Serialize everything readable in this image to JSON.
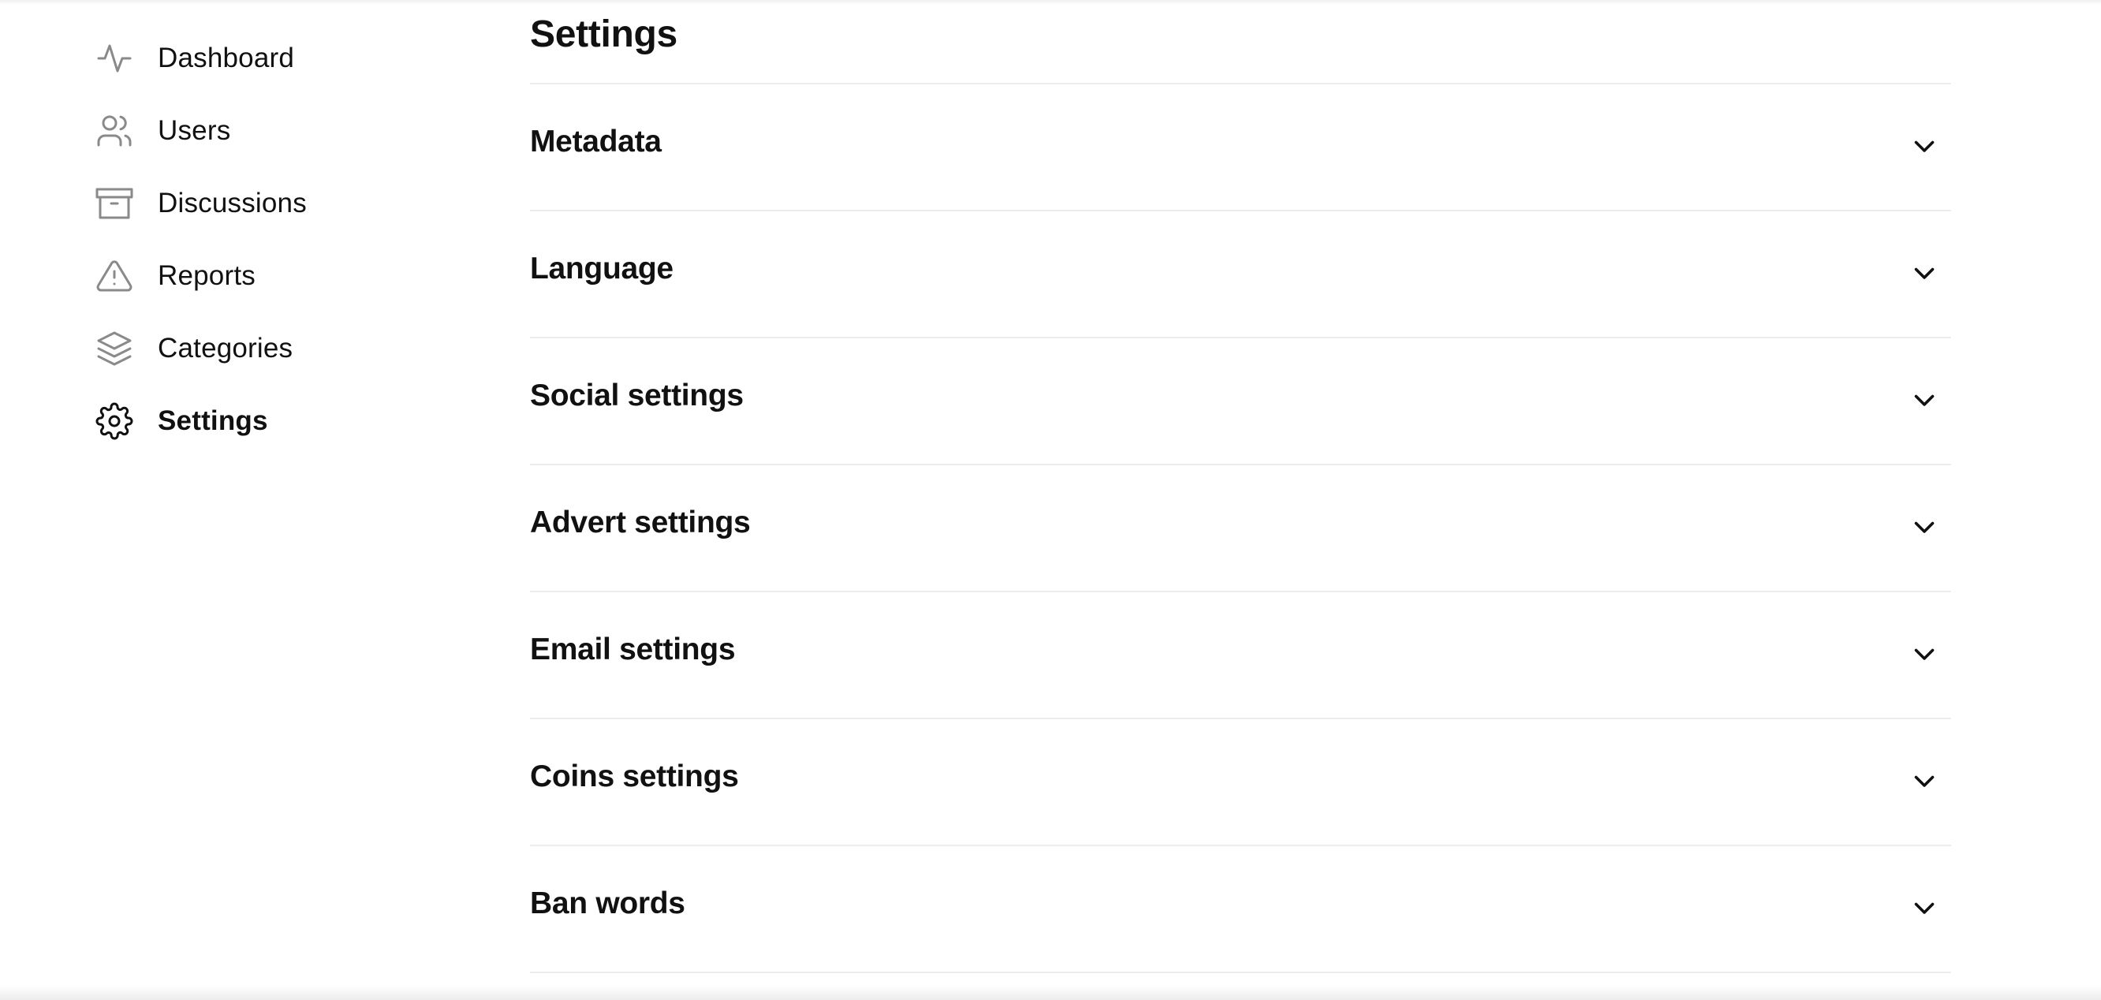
{
  "sidebar": {
    "items": [
      {
        "label": "Dashboard",
        "icon": "activity-icon",
        "active": false
      },
      {
        "label": "Users",
        "icon": "users-icon",
        "active": false
      },
      {
        "label": "Discussions",
        "icon": "archive-icon",
        "active": false
      },
      {
        "label": "Reports",
        "icon": "alert-triangle-icon",
        "active": false
      },
      {
        "label": "Categories",
        "icon": "layers-icon",
        "active": false
      },
      {
        "label": "Settings",
        "icon": "gear-icon",
        "active": true
      }
    ]
  },
  "main": {
    "title": "Settings",
    "sections": [
      {
        "label": "Metadata"
      },
      {
        "label": "Language"
      },
      {
        "label": "Social settings"
      },
      {
        "label": "Advert settings"
      },
      {
        "label": "Email settings"
      },
      {
        "label": "Coins settings"
      },
      {
        "label": "Ban words"
      }
    ]
  },
  "colors": {
    "text": "#111111",
    "icon_inactive": "#8a8a8a",
    "divider": "#ececec"
  }
}
